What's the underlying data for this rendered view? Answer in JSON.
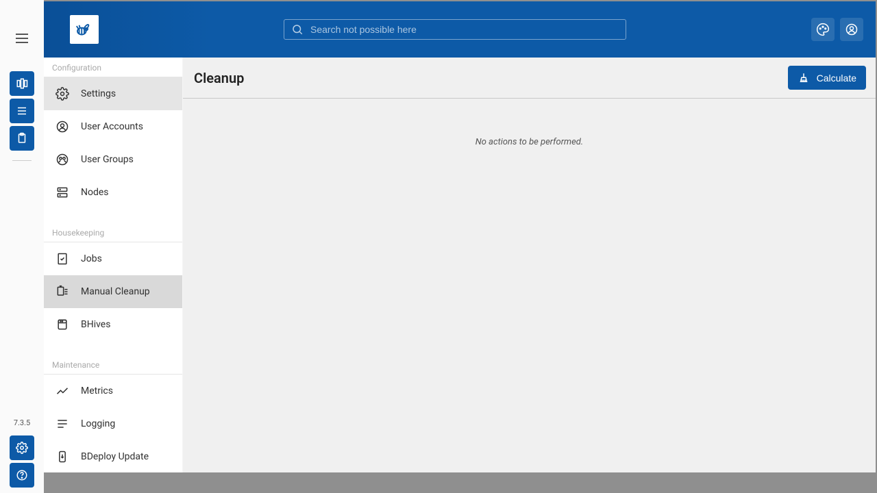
{
  "rail": {
    "version": "7.3.5"
  },
  "topbar": {
    "search_placeholder": "Search not possible here"
  },
  "sidebar": {
    "sections": {
      "configuration": {
        "label": "Configuration",
        "items": {
          "settings": "Settings",
          "user_accounts": "User Accounts",
          "user_groups": "User Groups",
          "nodes": "Nodes"
        }
      },
      "housekeeping": {
        "label": "Housekeeping",
        "items": {
          "jobs": "Jobs",
          "manual_cleanup": "Manual Cleanup",
          "bhives": "BHives"
        }
      },
      "maintenance": {
        "label": "Maintenance",
        "items": {
          "metrics": "Metrics",
          "logging": "Logging",
          "bdeploy_update": "BDeploy Update"
        }
      }
    }
  },
  "main": {
    "title": "Cleanup",
    "calculate_label": "Calculate",
    "empty_message": "No actions to be performed."
  }
}
